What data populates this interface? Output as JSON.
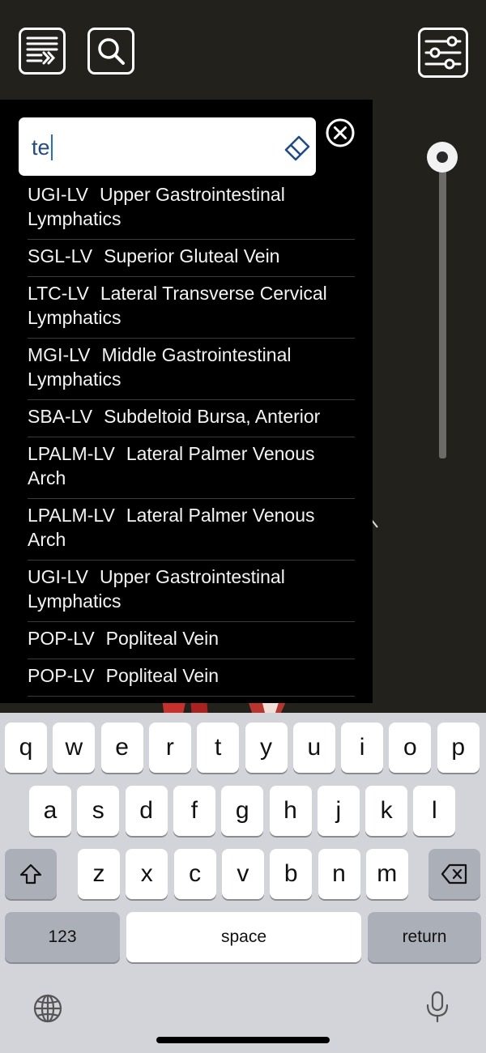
{
  "toolbar": {
    "menu_icon": "list-arrow-icon",
    "search_icon": "search-icon",
    "filter_icon": "sliders-icon"
  },
  "search": {
    "query": "te",
    "clear_icon": "eraser-icon",
    "close_icon": "close-circle-icon"
  },
  "results": [
    {
      "code": "UGI-LV",
      "name": "Upper Gastrointestinal Lymphatics"
    },
    {
      "code": "SGL-LV",
      "name": "Superior Gluteal Vein"
    },
    {
      "code": "LTC-LV",
      "name": "Lateral Transverse Cervical Lymphatics"
    },
    {
      "code": "MGI-LV",
      "name": "Middle Gastrointestinal Lymphatics"
    },
    {
      "code": "SBA-LV",
      "name": "Subdeltoid Bursa, Anterior"
    },
    {
      "code": "LPALM-LV",
      "name": "Lateral Palmer Venous Arch"
    },
    {
      "code": "LPALM-LV",
      "name": "Lateral Palmer Venous Arch"
    },
    {
      "code": "UGI-LV",
      "name": "Upper Gastrointestinal Lymphatics"
    },
    {
      "code": "POP-LV",
      "name": "Popliteal Vein"
    },
    {
      "code": "POP-LV",
      "name": "Popliteal Vein"
    }
  ],
  "zoom_slider": {
    "value": 0.0
  },
  "keyboard": {
    "row1": [
      "q",
      "w",
      "e",
      "r",
      "t",
      "y",
      "u",
      "i",
      "o",
      "p"
    ],
    "row2": [
      "a",
      "s",
      "d",
      "f",
      "g",
      "h",
      "j",
      "k",
      "l"
    ],
    "row3": [
      "z",
      "x",
      "c",
      "v",
      "b",
      "n",
      "m"
    ],
    "numbers_label": "123",
    "space_label": "space",
    "return_label": "return",
    "shift_icon": "shift-icon",
    "delete_icon": "delete-icon",
    "globe_icon": "globe-icon",
    "mic_icon": "microphone-icon"
  }
}
